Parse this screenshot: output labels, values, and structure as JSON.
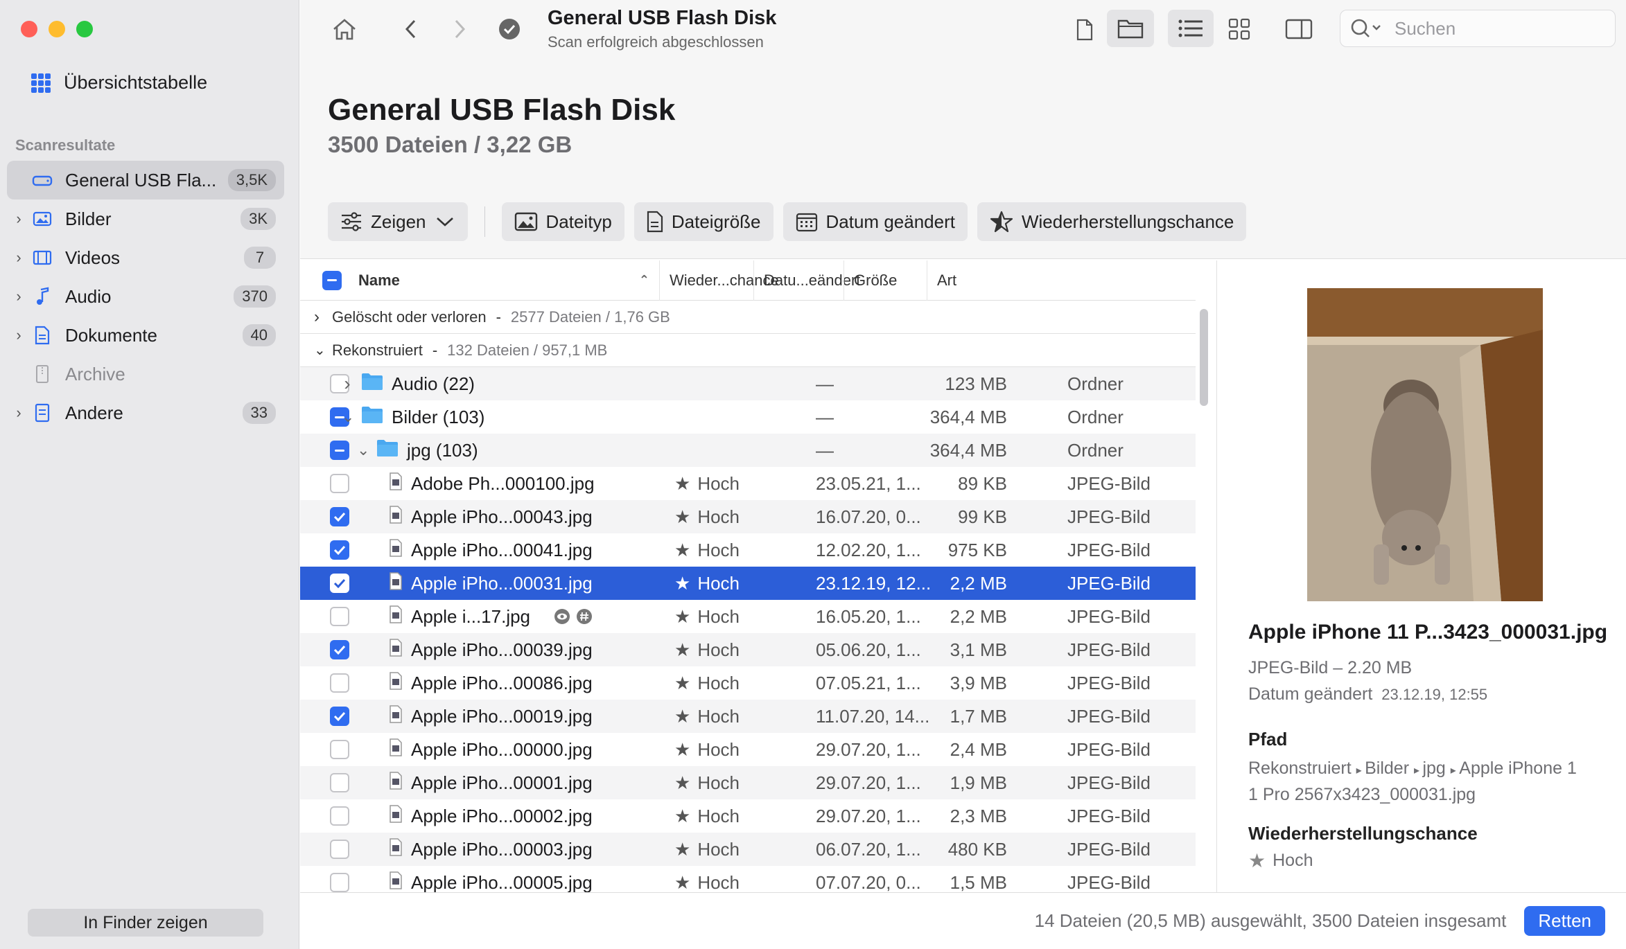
{
  "sidebar": {
    "overview_label": "Übersichtstabelle",
    "section_label": "Scanresultate",
    "items": [
      {
        "label": "General USB Fla...",
        "badge": "3,5K",
        "chevron": false,
        "icon": "drive-icon"
      },
      {
        "label": "Bilder",
        "badge": "3K",
        "chevron": true,
        "icon": "image-icon"
      },
      {
        "label": "Videos",
        "badge": "7",
        "chevron": true,
        "icon": "film-icon"
      },
      {
        "label": "Audio",
        "badge": "370",
        "chevron": true,
        "icon": "music-note-icon"
      },
      {
        "label": "Dokumente",
        "badge": "40",
        "chevron": true,
        "icon": "document-icon"
      },
      {
        "label": "Archive",
        "badge": "",
        "chevron": false,
        "icon": "archive-icon"
      },
      {
        "label": "Andere",
        "badge": "33",
        "chevron": true,
        "icon": "other-icon"
      }
    ],
    "finder_button": "In Finder zeigen"
  },
  "titlebar": {
    "title": "General USB Flash Disk",
    "subtitle": "Scan erfolgreich abgeschlossen",
    "search_placeholder": "Suchen"
  },
  "header": {
    "title": "General USB Flash Disk",
    "subtitle": "3500 Dateien / 3,22 GB"
  },
  "filters": {
    "show": "Zeigen",
    "file_type": "Dateityp",
    "file_size": "Dateigröße",
    "date_changed": "Datum geändert",
    "recovery_chance": "Wiederherstellungschance"
  },
  "table": {
    "columns": {
      "name": "Name",
      "chance": "Wieder...chance",
      "date": "Datu...eändert",
      "size": "Größe",
      "kind": "Art"
    },
    "groups": [
      {
        "label": "Gelöscht oder verloren",
        "detail": "2577 Dateien / 1,76 GB",
        "expanded": false
      },
      {
        "label": "Rekonstruiert",
        "detail": "132 Dateien / 957,1 MB",
        "expanded": true
      }
    ],
    "rows": [
      {
        "name": "Audio (22)",
        "type": "folder",
        "indent": 0,
        "chevron": "›",
        "check": "none",
        "chance": "",
        "date": "—",
        "size": "123 MB",
        "kind": "Ordner"
      },
      {
        "name": "Bilder (103)",
        "type": "folder",
        "indent": 0,
        "chevron": "⌄",
        "check": "mixed",
        "chance": "",
        "date": "—",
        "size": "364,4 MB",
        "kind": "Ordner"
      },
      {
        "name": "jpg (103)",
        "type": "folder",
        "indent": 1,
        "chevron": "⌄",
        "check": "mixed",
        "chance": "",
        "date": "—",
        "size": "364,4 MB",
        "kind": "Ordner"
      },
      {
        "name": "Adobe Ph...000100.jpg",
        "type": "file",
        "indent": 2,
        "check": "none",
        "chance": "Hoch",
        "date": "23.05.21, 1...",
        "size": "89 KB",
        "kind": "JPEG-Bild"
      },
      {
        "name": "Apple iPho...00043.jpg",
        "type": "file",
        "indent": 2,
        "check": "checked",
        "chance": "Hoch",
        "date": "16.07.20, 0...",
        "size": "99 KB",
        "kind": "JPEG-Bild"
      },
      {
        "name": "Apple iPho...00041.jpg",
        "type": "file",
        "indent": 2,
        "check": "checked",
        "chance": "Hoch",
        "date": "12.02.20, 1...",
        "size": "975 KB",
        "kind": "JPEG-Bild"
      },
      {
        "name": "Apple iPho...00031.jpg",
        "type": "file",
        "indent": 2,
        "check": "checked",
        "selected": true,
        "chance": "Hoch",
        "date": "23.12.19, 12...",
        "size": "2,2 MB",
        "kind": "JPEG-Bild"
      },
      {
        "name": "Apple i...17.jpg",
        "type": "file",
        "indent": 2,
        "check": "none",
        "extra_icons": true,
        "chance": "Hoch",
        "date": "16.05.20, 1...",
        "size": "2,2 MB",
        "kind": "JPEG-Bild"
      },
      {
        "name": "Apple iPho...00039.jpg",
        "type": "file",
        "indent": 2,
        "check": "checked",
        "chance": "Hoch",
        "date": "05.06.20, 1...",
        "size": "3,1 MB",
        "kind": "JPEG-Bild"
      },
      {
        "name": "Apple iPho...00086.jpg",
        "type": "file",
        "indent": 2,
        "check": "none",
        "chance": "Hoch",
        "date": "07.05.21, 1...",
        "size": "3,9 MB",
        "kind": "JPEG-Bild"
      },
      {
        "name": "Apple iPho...00019.jpg",
        "type": "file",
        "indent": 2,
        "check": "checked",
        "chance": "Hoch",
        "date": "11.07.20, 14...",
        "size": "1,7 MB",
        "kind": "JPEG-Bild"
      },
      {
        "name": "Apple iPho...00000.jpg",
        "type": "file",
        "indent": 2,
        "check": "none",
        "chance": "Hoch",
        "date": "29.07.20, 1...",
        "size": "2,4 MB",
        "kind": "JPEG-Bild"
      },
      {
        "name": "Apple iPho...00001.jpg",
        "type": "file",
        "indent": 2,
        "check": "none",
        "chance": "Hoch",
        "date": "29.07.20, 1...",
        "size": "1,9 MB",
        "kind": "JPEG-Bild"
      },
      {
        "name": "Apple iPho...00002.jpg",
        "type": "file",
        "indent": 2,
        "check": "none",
        "chance": "Hoch",
        "date": "29.07.20, 1...",
        "size": "2,3 MB",
        "kind": "JPEG-Bild"
      },
      {
        "name": "Apple iPho...00003.jpg",
        "type": "file",
        "indent": 2,
        "check": "none",
        "chance": "Hoch",
        "date": "06.07.20, 1...",
        "size": "480 KB",
        "kind": "JPEG-Bild"
      },
      {
        "name": "Apple iPho...00005.jpg",
        "type": "file",
        "indent": 2,
        "check": "none",
        "chance": "Hoch",
        "date": "07.07.20, 0...",
        "size": "1,5 MB",
        "kind": "JPEG-Bild"
      }
    ]
  },
  "preview": {
    "title": "Apple iPhone 11 P...3423_000031.jpg",
    "kind_size": "JPEG-Bild – 2.20 MB",
    "date_label": "Datum geändert",
    "date_value": "23.12.19, 12:55",
    "path_heading": "Pfad",
    "path": [
      "Rekonstruiert",
      "Bilder",
      "jpg",
      "Apple iPhone 1",
      "1 Pro 2567x3423_000031.jpg"
    ],
    "chance_heading": "Wiederherstellungschance",
    "chance_value": "Hoch"
  },
  "status": {
    "text": "14 Dateien (20,5 MB) ausgewählt, 3500 Dateien insgesamt",
    "button": "Retten"
  },
  "colors": {
    "accent": "#2f6cf0",
    "selection": "#2c5ed8",
    "traffic_close": "#ff5f57",
    "traffic_min": "#febc2e",
    "traffic_max": "#28c840"
  }
}
